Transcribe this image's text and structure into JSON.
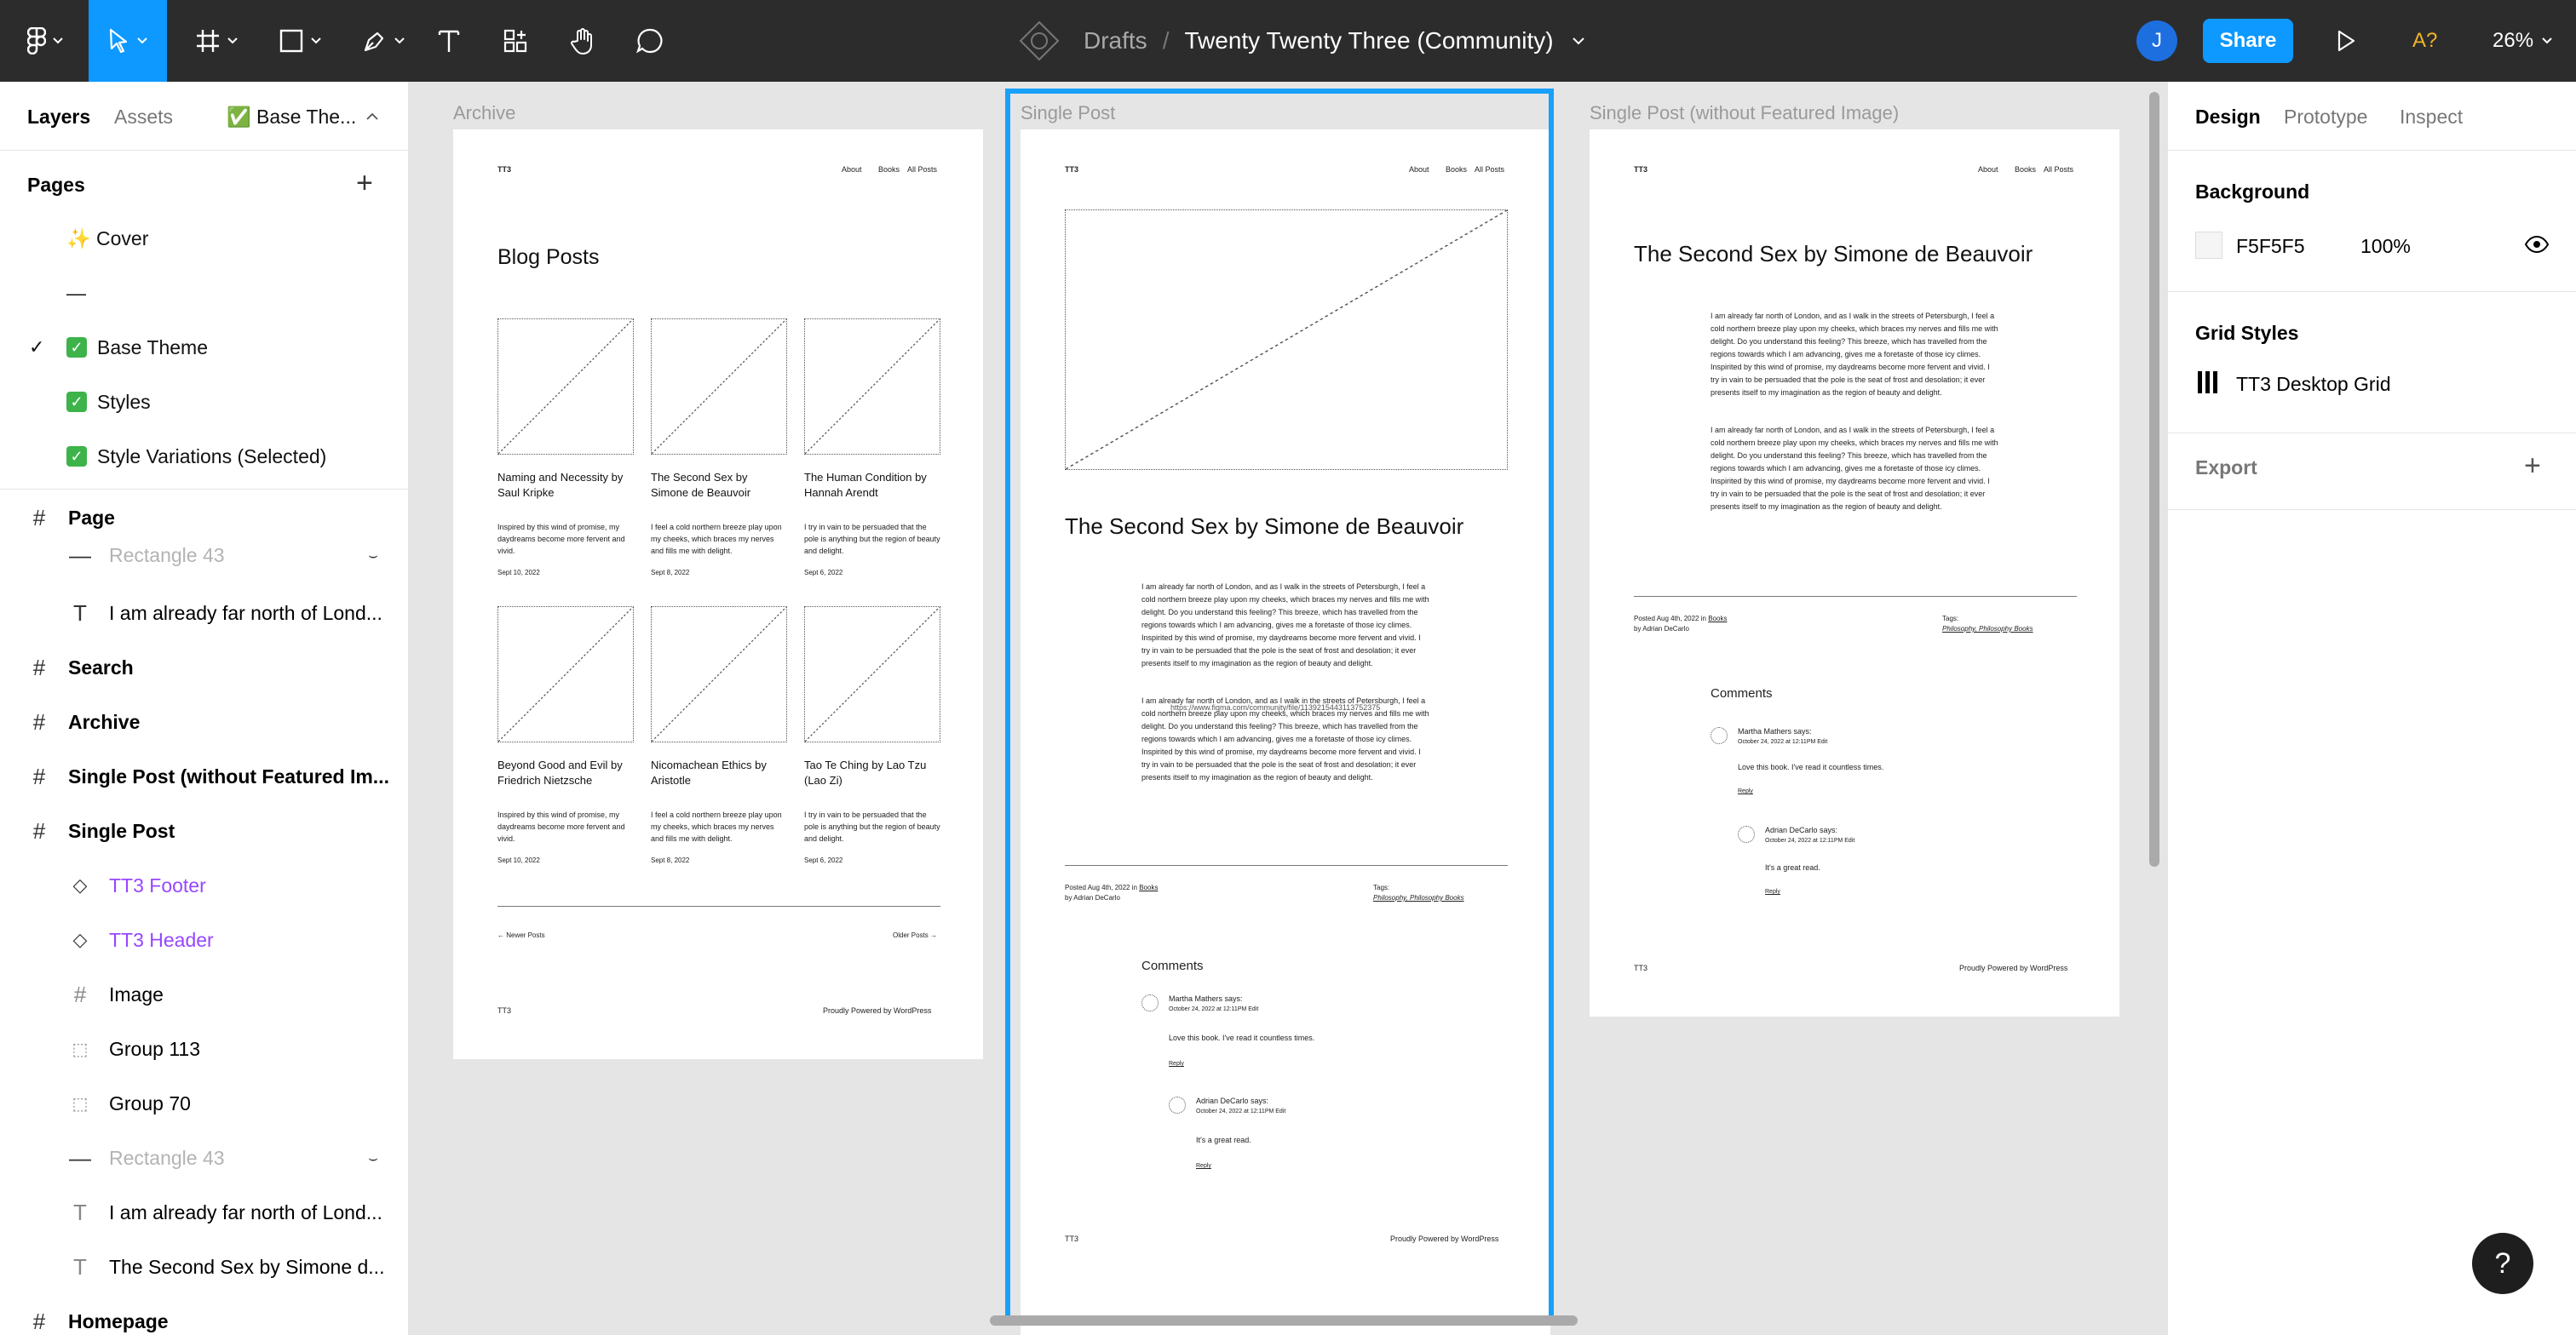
{
  "toolbar": {
    "breadcrumb_project": "Drafts",
    "breadcrumb_separator": "/",
    "file_name": "Twenty Twenty Three (Community)",
    "avatar_initial": "J",
    "share_label": "Share",
    "font_warning": "A?",
    "zoom": "26%"
  },
  "left_panel": {
    "tabs": [
      "Layers",
      "Assets"
    ],
    "current_page_tab": "✅ Base The...",
    "pages_heading": "Pages",
    "pages": [
      {
        "label": "✨ Cover"
      },
      {
        "label": "—"
      },
      {
        "label": "Base Theme",
        "selected": true
      },
      {
        "label": "Styles"
      },
      {
        "label": "Style Variations (Selected)"
      }
    ],
    "layers": [
      {
        "label": "Page",
        "type": "frame",
        "bold": true
      },
      {
        "label": "Rectangle 43",
        "type": "line",
        "hidden": true
      },
      {
        "label": "I am already far north of Lond...",
        "type": "text"
      },
      {
        "label": "Search",
        "type": "frame",
        "bold": true
      },
      {
        "label": "Archive",
        "type": "frame",
        "bold": true
      },
      {
        "label": "Single Post (without Featured Im...",
        "type": "frame",
        "bold": true
      },
      {
        "label": "Single Post",
        "type": "frame",
        "bold": true
      },
      {
        "label": "TT3 Footer",
        "type": "instance"
      },
      {
        "label": "TT3 Header",
        "type": "instance"
      },
      {
        "label": "Image",
        "type": "frame"
      },
      {
        "label": "Group 113",
        "type": "group"
      },
      {
        "label": "Group 70",
        "type": "group"
      },
      {
        "label": "Rectangle 43",
        "type": "line",
        "hidden": true
      },
      {
        "label": "I am already far north of Lond...",
        "type": "text"
      },
      {
        "label": "The Second Sex by Simone d...",
        "type": "text"
      },
      {
        "label": "Homepage",
        "type": "frame",
        "bold": true
      }
    ]
  },
  "canvas": {
    "frames": {
      "archive": {
        "label": "Archive",
        "logo": "TT3",
        "nav": [
          "About",
          "Books",
          "All Posts"
        ],
        "heading": "Blog Posts",
        "posts": [
          {
            "title": "Naming and Necessity by Saul Kripke",
            "excerpt": "Inspired by this wind of promise, my daydreams become more fervent and vivid.",
            "date": "Sept 10, 2022"
          },
          {
            "title": "The Second Sex by Simone de Beauvoir",
            "excerpt": "I feel a cold northern breeze play upon my cheeks, which braces my nerves and fills me with delight.",
            "date": "Sept 8, 2022"
          },
          {
            "title": "The Human Condition by Hannah Arendt",
            "excerpt": "I try in vain to be persuaded that the pole is anything but the region of beauty and delight.",
            "date": "Sept 6, 2022"
          },
          {
            "title": "Beyond Good and Evil by Friedrich Nietzsche",
            "excerpt": "Inspired by this wind of promise, my daydreams become more fervent and vivid.",
            "date": "Sept 10, 2022"
          },
          {
            "title": "Nicomachean Ethics by Aristotle",
            "excerpt": "I feel a cold northern breeze play upon my cheeks, which braces my nerves and fills me with delight.",
            "date": "Sept 8, 2022"
          },
          {
            "title": "Tao Te Ching by Lao Tzu (Lao Zi)",
            "excerpt": "I try in vain to be persuaded that the pole is anything but the region of beauty and delight.",
            "date": "Sept 6, 2022"
          }
        ],
        "newer": "← Newer Posts",
        "older": "Older Posts →",
        "footer_left": "TT3",
        "footer_right": "Proudly Powered by WordPress"
      },
      "single": {
        "label": "Single Post",
        "logo": "TT3",
        "nav": [
          "About",
          "Books",
          "All Posts"
        ],
        "title": "The Second Sex by Simone de Beauvoir",
        "para1": "I am already far north of London, and as I walk in the streets of Petersburgh, I feel a cold northern breeze play upon my cheeks, which braces my nerves and fills me with delight. Do you understand this feeling? This breeze, which has travelled from the regions towards which I am advancing, gives me a foretaste of those icy climes. Inspirited by this wind of promise, my daydreams become more fervent and vivid. I try in vain to be persuaded that the pole is the seat of frost and desolation; it ever presents itself to my imagination as the region of beauty and delight.",
        "para2": "I am already far north of London, and as I walk in the streets of Petersburgh, I feel a cold northern breeze play upon my cheeks, which braces my nerves and fills me with delight. Do you understand this feeling? This breeze, which has travelled from the regions towards which I am advancing, gives me a foretaste of those icy climes. Inspirited by this wind of promise, my daydreams become more fervent and vivid. I try in vain to be persuaded that the pole is the seat of frost and desolation; it ever presents itself to my imagination as the region of beauty and delight.",
        "overlap_link": "https://www.figma.com/community/file/1139215443113752375",
        "posted": "Posted Aug 4th, 2022 in",
        "posted_cat": "Books",
        "by": "by Adrian DeCarlo",
        "tags_label": "Tags:",
        "tags": "Philosophy, Philosophy Books",
        "comments_heading": "Comments",
        "comment1_author": "Martha Mathers says:",
        "comment1_date": "October 24, 2022 at 12:11PM Edit",
        "comment1_text": "Love this book. I've read it countless times.",
        "comment2_author": "Adrian DeCarlo says:",
        "comment2_date": "October 24, 2022 at 12:11PM Edit",
        "comment2_text": "It's a great read.",
        "reply": "Reply",
        "footer_left": "TT3",
        "footer_right": "Proudly Powered by WordPress"
      },
      "single_nofeat": {
        "label": "Single Post (without Featured Image)"
      }
    }
  },
  "right_panel": {
    "tabs": [
      "Design",
      "Prototype",
      "Inspect"
    ],
    "background_heading": "Background",
    "background_hex": "F5F5F5",
    "background_opacity": "100%",
    "grid_styles_heading": "Grid Styles",
    "grid_style_name": "TT3 Desktop Grid",
    "export_heading": "Export"
  },
  "help_label": "?",
  "colors": {
    "toolbar": "#2c2c2c",
    "accent": "#0d99ff",
    "selection": "#18a0fb",
    "component": "#9747ff",
    "canvas": "#e5e5e5"
  }
}
